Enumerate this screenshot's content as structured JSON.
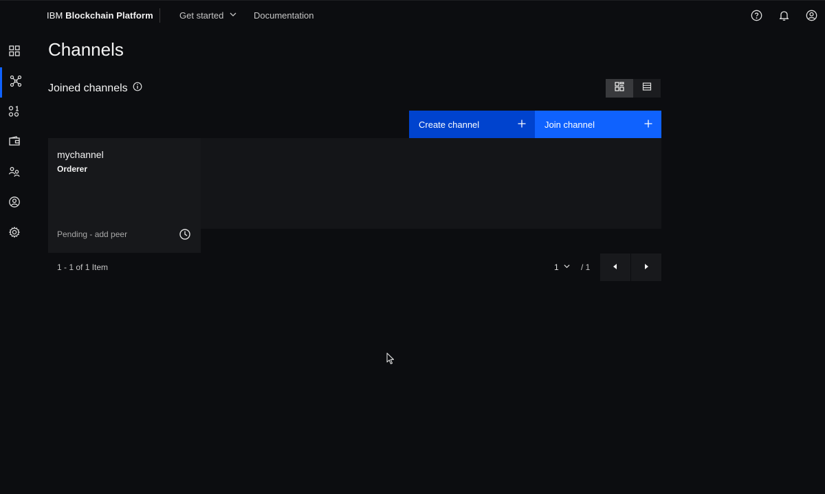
{
  "header": {
    "brand_prefix": "IBM",
    "brand_name": "Blockchain Platform",
    "nav": {
      "get_started": "Get started",
      "documentation": "Documentation"
    },
    "icons": [
      "help-icon",
      "notification-icon",
      "user-avatar-icon"
    ]
  },
  "sidebar": {
    "items": [
      {
        "icon": "dashboard-icon",
        "active": false
      },
      {
        "icon": "nodes-icon",
        "active": true
      },
      {
        "icon": "channels-icon",
        "active": false
      },
      {
        "icon": "wallet-icon",
        "active": false
      },
      {
        "icon": "organizations-icon",
        "active": false
      },
      {
        "icon": "users-icon",
        "active": false
      },
      {
        "icon": "settings-icon",
        "active": false
      }
    ]
  },
  "main": {
    "title": "Channels",
    "section_title": "Joined channels",
    "view_toggle": {
      "grid": "grid-view-icon",
      "list": "list-view-icon",
      "selected": "grid"
    },
    "actions": {
      "create": "Create channel",
      "join": "Join channel"
    },
    "tiles": [
      {
        "name": "mychannel",
        "subtitle": "Orderer",
        "status": "Pending - add peer",
        "status_icon": "clock-icon"
      }
    ],
    "pagination": {
      "count_text": "1 - 1 of 1 Item",
      "current_page": "1",
      "total_pages": "/ 1"
    }
  },
  "colors": {
    "background": "#0c0d10",
    "primary_blue": "#0f62fe",
    "primary_blue_dark": "#0043ce",
    "text": "#f4f4f4"
  }
}
